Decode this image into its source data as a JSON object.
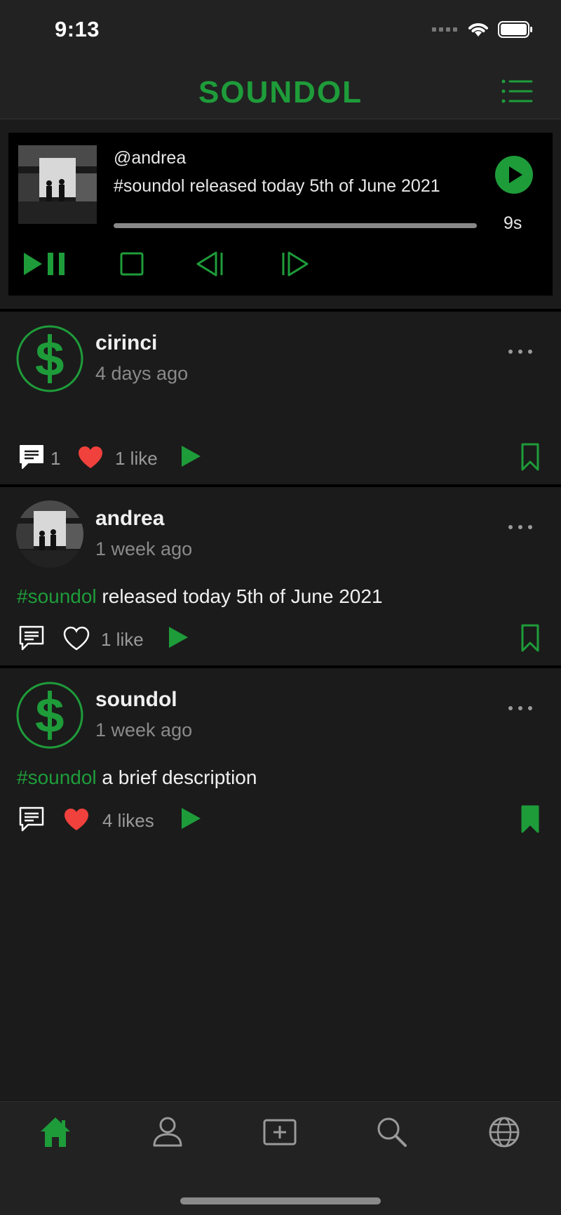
{
  "status": {
    "time": "9:13"
  },
  "header": {
    "brand": "SOUNDOL"
  },
  "player": {
    "user": "@andrea",
    "description": "#soundol released today 5th of June 2021",
    "remaining": "9s",
    "progress_fraction": 1.0
  },
  "posts": [
    {
      "username": "cirinci",
      "time_ago": "4 days ago",
      "tag": "",
      "caption": "",
      "comments": "1",
      "likes": "1 like",
      "liked": true,
      "bookmarked": false
    },
    {
      "username": "andrea",
      "time_ago": "1 week ago",
      "tag": "#soundol",
      "caption": " released today 5th of June 2021",
      "comments": "",
      "likes": "1 like",
      "liked": false,
      "bookmarked": false
    },
    {
      "username": "soundol",
      "time_ago": "1 week ago",
      "tag": "#soundol",
      "caption": " a brief description",
      "comments": "",
      "likes": "4 likes",
      "liked": true,
      "bookmarked": true
    }
  ],
  "tabs": [
    "home-icon",
    "profile-icon",
    "add-post-icon",
    "search-icon",
    "globe-icon"
  ],
  "colors": {
    "accent": "#1e9c3a",
    "like": "#f0413c",
    "background": "#1b1b1b"
  }
}
